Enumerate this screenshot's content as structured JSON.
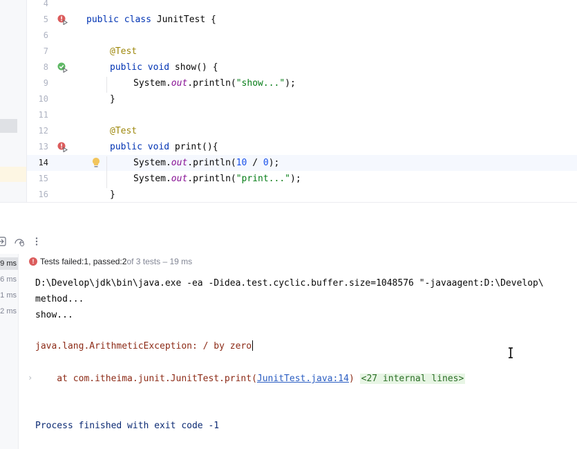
{
  "editor": {
    "lines": [
      {
        "num": "4"
      },
      {
        "num": "5",
        "gutter": "run-failed",
        "parts": [
          [
            "kw",
            "public class "
          ],
          [
            "",
            "JunitTest {"
          ]
        ]
      },
      {
        "num": "6"
      },
      {
        "num": "7",
        "parts": [
          [
            "ann",
            "@Test"
          ]
        ]
      },
      {
        "num": "8",
        "gutter": "run-passed",
        "parts": [
          [
            "kw",
            "public void "
          ],
          [
            "",
            "show() {"
          ]
        ]
      },
      {
        "num": "9",
        "parts": [
          [
            "",
            "System."
          ],
          [
            "fld",
            "out"
          ],
          [
            "",
            ".println("
          ],
          [
            "str",
            "\"show...\""
          ],
          [
            "",
            ");"
          ]
        ]
      },
      {
        "num": "10",
        "parts": [
          [
            "",
            "}"
          ]
        ]
      },
      {
        "num": "11"
      },
      {
        "num": "12",
        "parts": [
          [
            "ann",
            "@Test"
          ]
        ]
      },
      {
        "num": "13",
        "gutter": "run-failed",
        "parts": [
          [
            "kw",
            "public void "
          ],
          [
            "",
            "print(){"
          ]
        ]
      },
      {
        "num": "14",
        "current": true,
        "bulb": true,
        "parts": [
          [
            "",
            "System."
          ],
          [
            "fld",
            "out"
          ],
          [
            "",
            ".println("
          ],
          [
            "num",
            "10"
          ],
          [
            "",
            " / "
          ],
          [
            "num",
            "0"
          ],
          [
            "",
            ");"
          ]
        ]
      },
      {
        "num": "15",
        "parts": [
          [
            "",
            "System."
          ],
          [
            "fld",
            "out"
          ],
          [
            "",
            ".println("
          ],
          [
            "str",
            "\"print...\""
          ],
          [
            "",
            ");"
          ]
        ]
      },
      {
        "num": "16",
        "parts": [
          [
            "",
            "}"
          ]
        ]
      }
    ]
  },
  "test_results": {
    "failed_label": "Tests failed: ",
    "failed_count": "1",
    "passed_label": ", passed: ",
    "passed_count": "2",
    "summary": " of 3 tests – 19 ms",
    "durations": [
      "9 ms",
      "6 ms",
      "1 ms",
      "2 ms"
    ]
  },
  "console": {
    "command": "D:\\Develop\\jdk\\bin\\java.exe -ea -Didea.test.cyclic.buffer.size=1048576 \"-javaagent:D:\\Develop\\",
    "out1": "method...",
    "out2": "show...",
    "exception": "java.lang.ArithmeticException: / by zero",
    "trace_prefix": "    at com.itheima.junit.JunitTest.print(",
    "trace_link": "JunitTest.java:14",
    "trace_suffix": ")",
    "internal_lines": "<27 internal lines>",
    "exit": "Process finished with exit code -1"
  },
  "colors": {
    "failed": "#db5c5c",
    "passed": "#5fb865",
    "accent": "#3574f0"
  }
}
